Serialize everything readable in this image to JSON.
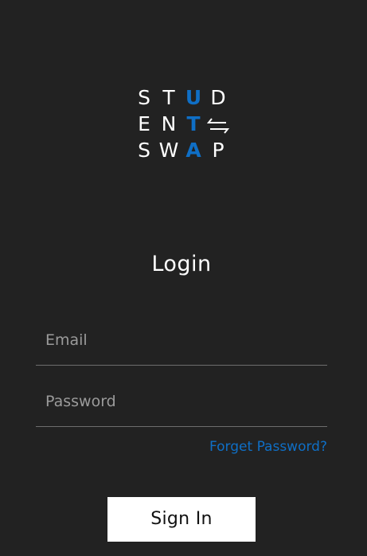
{
  "logo": {
    "rows": [
      [
        "S",
        "T",
        "U",
        "D"
      ],
      [
        "E",
        "N",
        "T",
        ""
      ],
      [
        "S",
        "W",
        "A",
        "P"
      ]
    ],
    "accent_color": "#0f6fc6",
    "swap_icon": "swap-arrows-icon"
  },
  "title": "Login",
  "email": {
    "placeholder": "Email",
    "value": ""
  },
  "password": {
    "placeholder": "Password",
    "value": ""
  },
  "forgot_password_label": "Forget Password?",
  "sign_in_label": "Sign In",
  "colors": {
    "background": "#222222",
    "accent": "#0f6fc6",
    "button_bg": "#ffffff",
    "underline": "#6d6d6d"
  }
}
